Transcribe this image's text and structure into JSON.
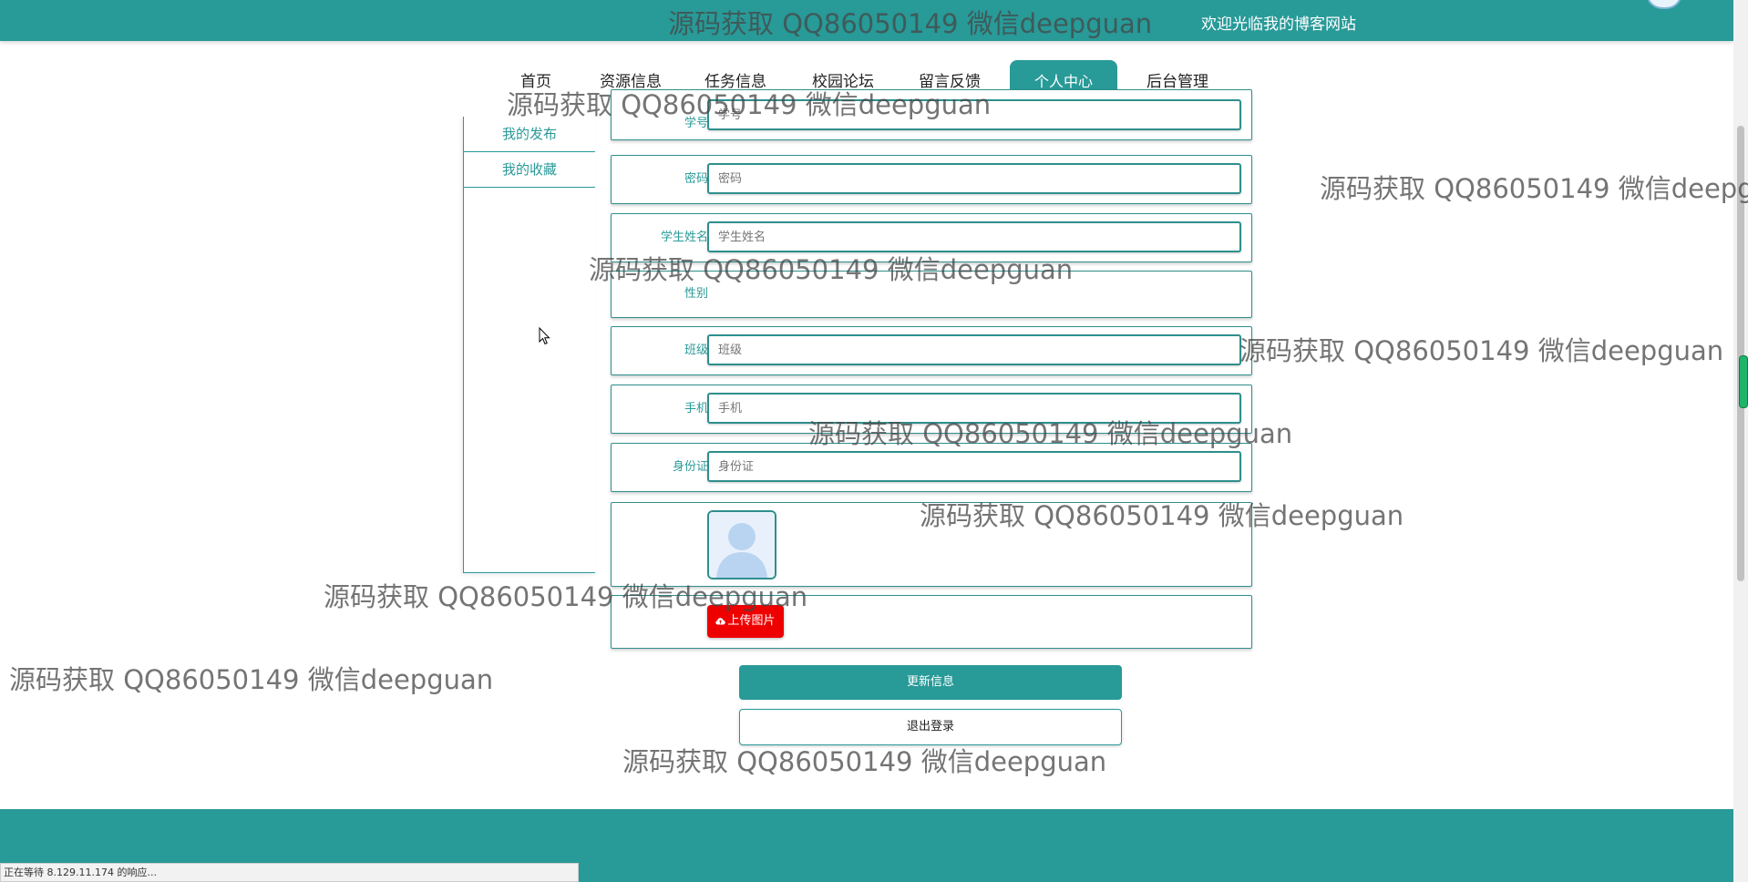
{
  "header": {
    "welcome": "欢迎光临我的博客网站"
  },
  "nav": {
    "items": [
      {
        "label": "首页"
      },
      {
        "label": "资源信息"
      },
      {
        "label": "任务信息"
      },
      {
        "label": "校园论坛"
      },
      {
        "label": "留言反馈"
      },
      {
        "label": "个人中心",
        "active": true
      },
      {
        "label": "后台管理"
      }
    ]
  },
  "sidebar": {
    "items": [
      {
        "label": "我的发布"
      },
      {
        "label": "我的收藏"
      }
    ]
  },
  "form": {
    "fields": [
      {
        "label": "学号",
        "placeholder": "学号"
      },
      {
        "label": "密码",
        "placeholder": "密码"
      },
      {
        "label": "学生姓名",
        "placeholder": "学生姓名"
      },
      {
        "label": "性别",
        "placeholder": ""
      },
      {
        "label": "班级",
        "placeholder": "班级"
      },
      {
        "label": "手机",
        "placeholder": "手机"
      },
      {
        "label": "身份证",
        "placeholder": "身份证"
      }
    ],
    "upload_label": "上传图片",
    "update_label": "更新信息",
    "logout_label": "退出登录"
  },
  "status_bar": {
    "text": "正在等待 8.129.11.174 的响应..."
  },
  "watermark": {
    "text": "源码获取 QQ86050149 微信deepguan"
  },
  "colors": {
    "accent": "#289a98",
    "upload": "#ee0000"
  }
}
